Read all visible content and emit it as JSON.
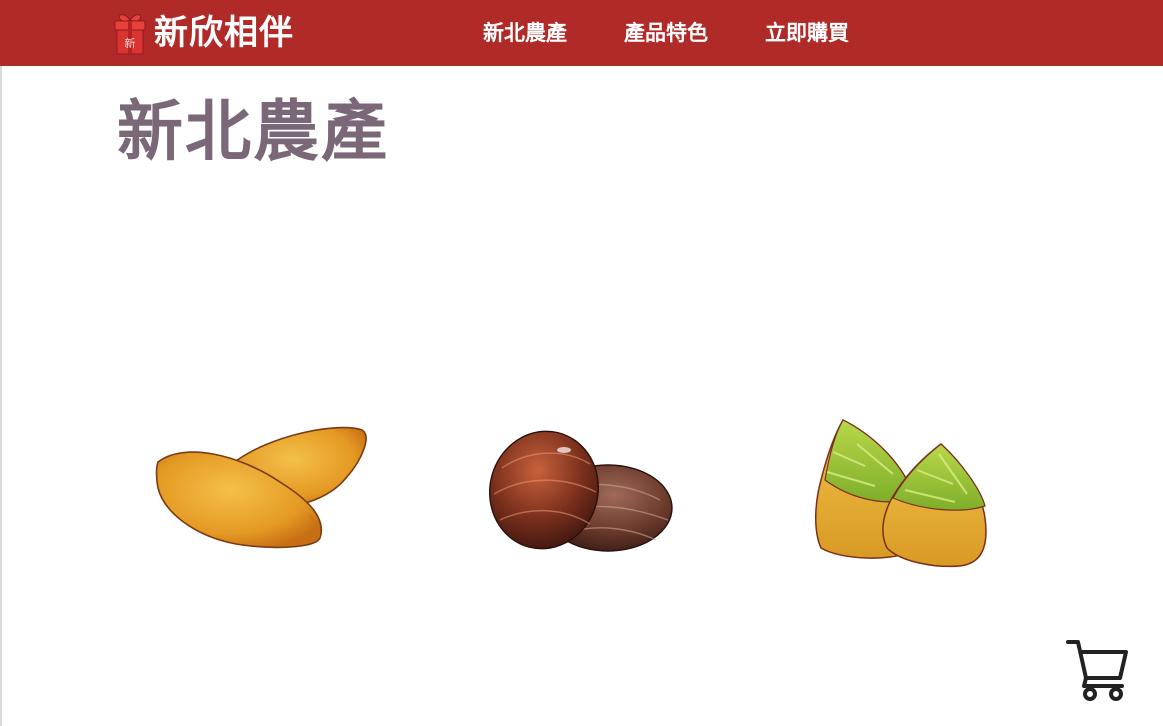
{
  "header": {
    "brand": "新欣相伴",
    "brand_color": "#b02a28",
    "logo_icon": "gift-box-icon",
    "nav": [
      {
        "label": "新北農產"
      },
      {
        "label": "產品特色"
      },
      {
        "label": "立即購買"
      }
    ]
  },
  "main": {
    "title": "新北農產",
    "title_color": "#7a6878",
    "products": [
      {
        "icon": "sweet-potato-cake-icon"
      },
      {
        "icon": "chestnut-chocolate-icon"
      },
      {
        "icon": "bamboo-shoot-cake-icon"
      }
    ]
  },
  "floating": {
    "icon": "shopping-cart-icon"
  }
}
